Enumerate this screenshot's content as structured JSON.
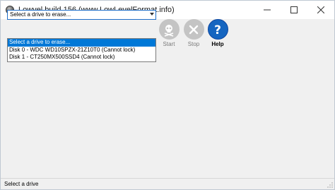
{
  "window": {
    "title": "Lowvel build 156 (www.LowLevelFormat.info)"
  },
  "drive_select": {
    "value": "Select a drive to erase...",
    "options": [
      "Select a drive to erase...",
      "Disk 0 - WDC WD10SPZX-21Z10T0 (Cannot lock)",
      "Disk 1 - CT250MX500SSD4 (Cannot lock)"
    ]
  },
  "toolbar": {
    "start_label": "Start",
    "stop_label": "Stop",
    "help_label": "Help",
    "start_icon": "skull-icon",
    "stop_icon": "x-icon",
    "help_icon": "question-icon"
  },
  "status": {
    "text": "Select a drive"
  },
  "colors": {
    "accent_blue": "#0078d7",
    "help_blue": "#1565c0",
    "disabled_gray": "#c4c4c4"
  }
}
